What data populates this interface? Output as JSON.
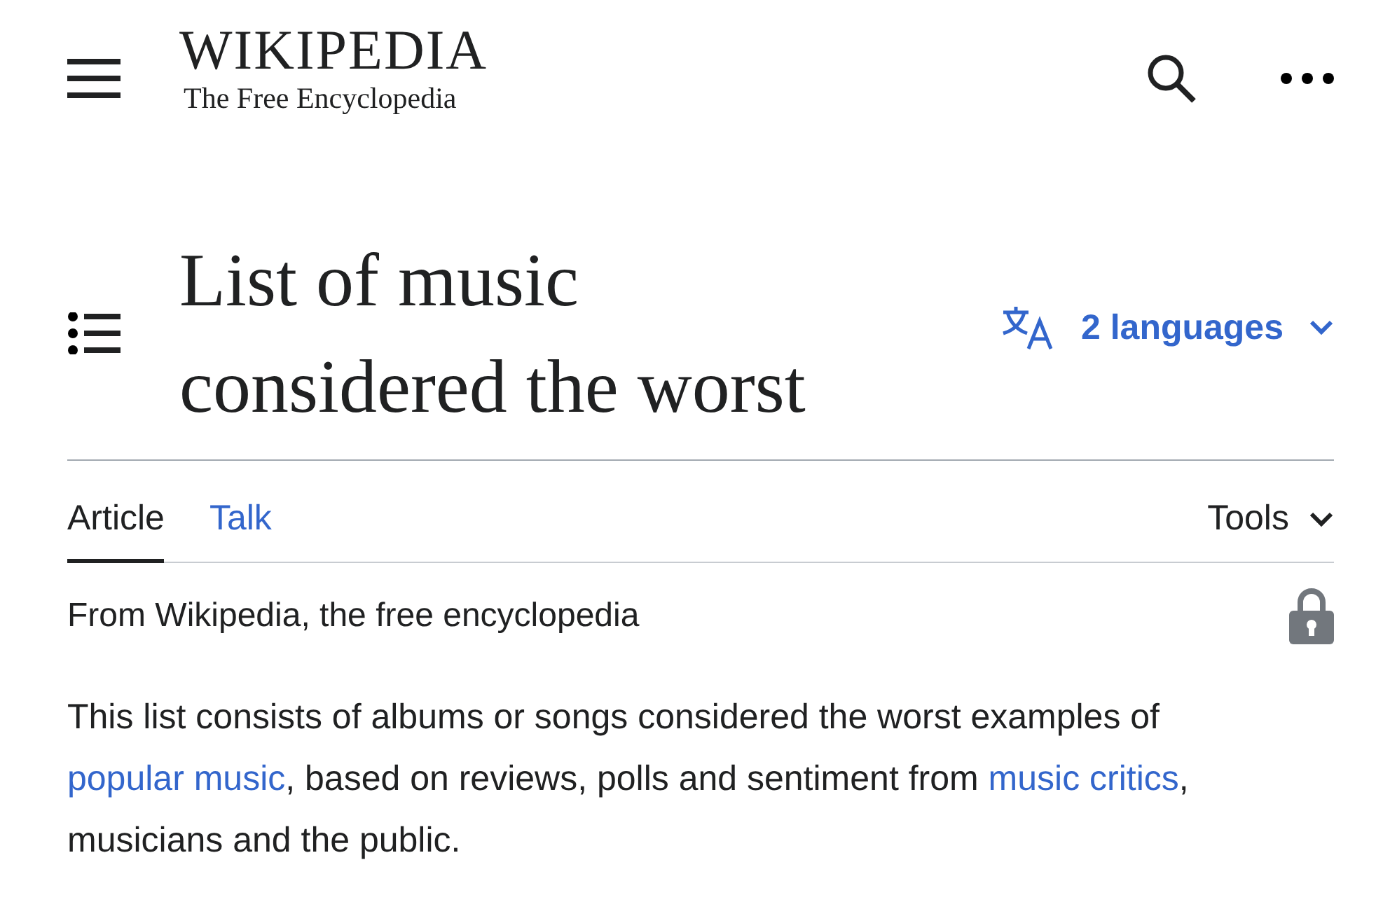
{
  "header": {
    "wordmark": "WIKIPEDIA",
    "tagline": "The Free Encyclopedia"
  },
  "title": {
    "lines": [
      "List of music",
      "considered the worst"
    ]
  },
  "languages": {
    "label": "2 languages"
  },
  "tabs": [
    {
      "label": "Article",
      "selected": true
    },
    {
      "label": "Talk",
      "selected": false
    }
  ],
  "tools": {
    "label": "Tools"
  },
  "siteSub": "From Wikipedia, the free encyclopedia",
  "paragraph": [
    {
      "text": "This list consists of albums or songs considered the worst examples of ",
      "kind": "text"
    },
    {
      "text": "popular music",
      "kind": "link"
    },
    {
      "text": ", based on reviews, polls and sentiment from ",
      "kind": "text"
    },
    {
      "text": "music critics",
      "kind": "link"
    },
    {
      "text": ", musicians and the public.",
      "kind": "text"
    }
  ]
}
